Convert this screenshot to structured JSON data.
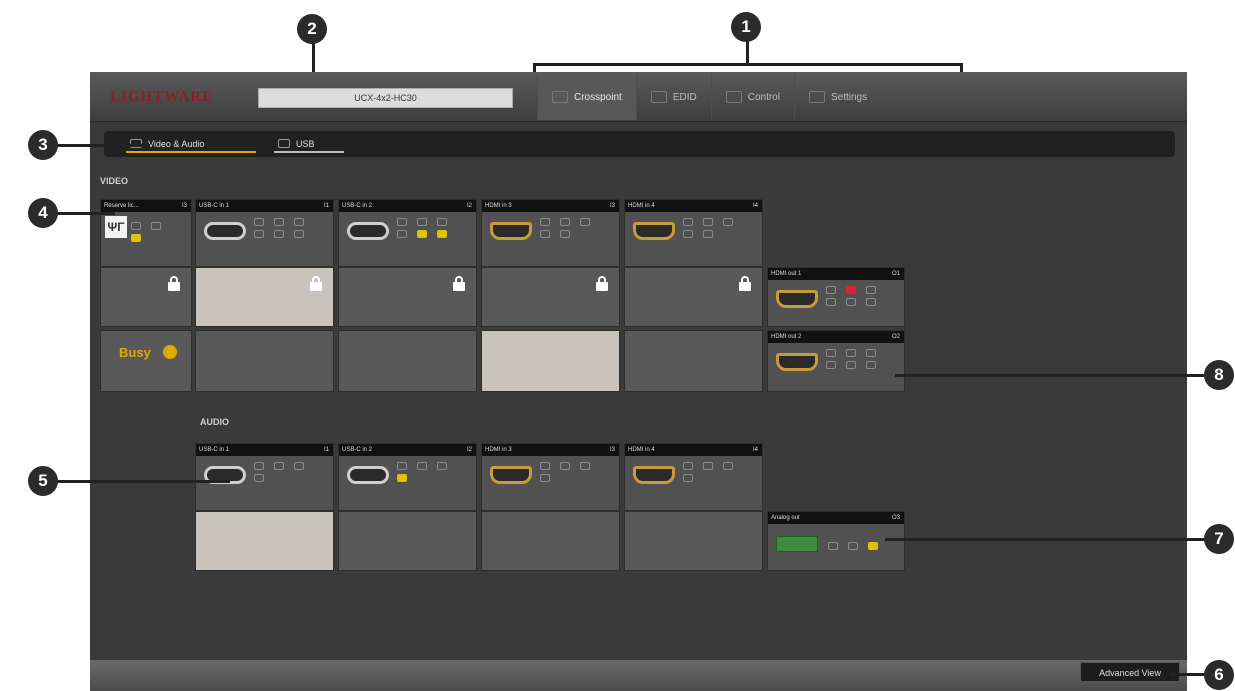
{
  "header": {
    "logo": "LIGHTWARE",
    "device_name": "UCX-4x2-HC30",
    "menu": [
      {
        "label": "Crosspoint",
        "icon": "crosspoint-icon",
        "active": true
      },
      {
        "label": "EDID",
        "icon": "edid-icon",
        "active": false
      },
      {
        "label": "Control",
        "icon": "control-icon",
        "active": false
      },
      {
        "label": "Settings",
        "icon": "settings-icon",
        "active": false
      }
    ]
  },
  "tabs": [
    {
      "label": "Video & Audio",
      "icon": "monitor-icon"
    },
    {
      "label": "USB",
      "icon": "usb-icon"
    }
  ],
  "video": {
    "label": "VIDEO",
    "inputs": [
      {
        "name": "Reserve lic...",
        "num": "I3"
      },
      {
        "name": "USB-C in 1",
        "num": "I1"
      },
      {
        "name": "USB-C in 2",
        "num": "I2"
      },
      {
        "name": "HDMI in 3",
        "num": "I3"
      },
      {
        "name": "HDMI in 4",
        "num": "I4"
      }
    ],
    "outputs": [
      {
        "name": "HDMI out 1",
        "num": "O1"
      },
      {
        "name": "HDMI out 2",
        "num": "O2"
      }
    ],
    "busy_label": "Busy"
  },
  "audio": {
    "label": "AUDIO",
    "inputs": [
      {
        "name": "USB-C in 1",
        "num": "I1"
      },
      {
        "name": "USB-C in 2",
        "num": "I2"
      },
      {
        "name": "HDMI in 3",
        "num": "I3"
      },
      {
        "name": "HDMI in 4",
        "num": "I4"
      }
    ],
    "output": {
      "name": "Analog out",
      "num": "O3"
    }
  },
  "footer": {
    "advanced_view": "Advanced View"
  },
  "callouts": [
    "1",
    "2",
    "3",
    "4",
    "5",
    "6",
    "7",
    "8"
  ],
  "colors": {
    "accent": "#e0a800",
    "brand": "#8b1f22",
    "hdmi": "#c89a3a"
  }
}
